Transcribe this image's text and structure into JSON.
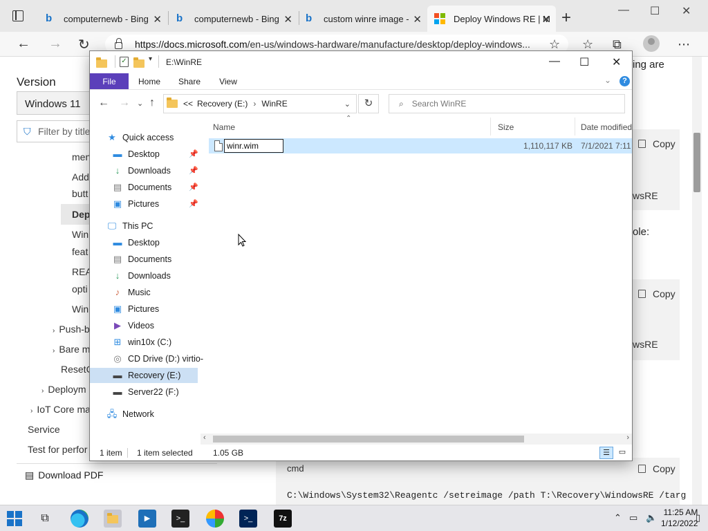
{
  "browser": {
    "tabs": [
      {
        "label": "computernewb - Bing",
        "favicon": "bing-icon"
      },
      {
        "label": "computernewb - Bing",
        "favicon": "bing-icon"
      },
      {
        "label": "custom winre image -",
        "favicon": "bing-icon"
      },
      {
        "label": "Deploy Windows RE | M",
        "favicon": "microsoft-logo-icon",
        "active": true
      }
    ],
    "url_host": "https://docs.microsoft.com",
    "url_path": "/en-us/windows-hardware/manufacture/desktop/deploy-windows...",
    "accent": "#1a73c8"
  },
  "docs": {
    "version_label": "Version",
    "version_select": "Windows 11",
    "filter_placeholder": "Filter by title",
    "toc": [
      "men",
      "Add",
      "butt",
      "Dep",
      "Win",
      "feat",
      "REA",
      "opti",
      "Win",
      "Push-b",
      "Bare m",
      "ResetC",
      "Deploym",
      "IoT Core ma",
      "Service",
      "Test for perfor"
    ],
    "download_pdf": "Download PDF",
    "tail_1": "ing are",
    "tail_2": "ole:",
    "code_tail_1": "wsRE",
    "code_tail_2": "wsRE",
    "copy_label": "Copy",
    "code_lang": "cmd",
    "code_line": "C:\\Windows\\System32\\Reagentc /setreimage /path T:\\Recovery\\WindowsRE /targ"
  },
  "explorer": {
    "title_path": "E:\\WinRE",
    "ribbon_tabs": [
      "File",
      "Home",
      "Share",
      "View"
    ],
    "ribbon_active": "File",
    "ribbon_accent": "#5b3fba",
    "breadcrumb": [
      "Recovery (E:)",
      "WinRE"
    ],
    "breadcrumb_prefix": "<<",
    "search_placeholder": "Search WinRE",
    "nav_pane": {
      "quick_access": "Quick access",
      "quick_items": [
        "Desktop",
        "Downloads",
        "Documents",
        "Pictures"
      ],
      "this_pc": "This PC",
      "pc_items": [
        "Desktop",
        "Documents",
        "Downloads",
        "Music",
        "Pictures",
        "Videos",
        "win10x (C:)",
        "CD Drive (D:) virtio-",
        "Recovery (E:)",
        "Server22 (F:)"
      ],
      "network": "Network",
      "selected": "Recovery (E:)"
    },
    "columns": [
      "Name",
      "Size",
      "Date modified"
    ],
    "files": [
      {
        "name": "winr.wim",
        "size": "1,110,117 KB",
        "date": "7/1/2021 7:11"
      }
    ],
    "rename_value": "winr.wim",
    "status_items": "1 item",
    "status_selected": "1 item selected",
    "status_size": "1.05 GB"
  },
  "taskbar": {
    "time": "11:25 AM",
    "date": "1/12/2022"
  }
}
